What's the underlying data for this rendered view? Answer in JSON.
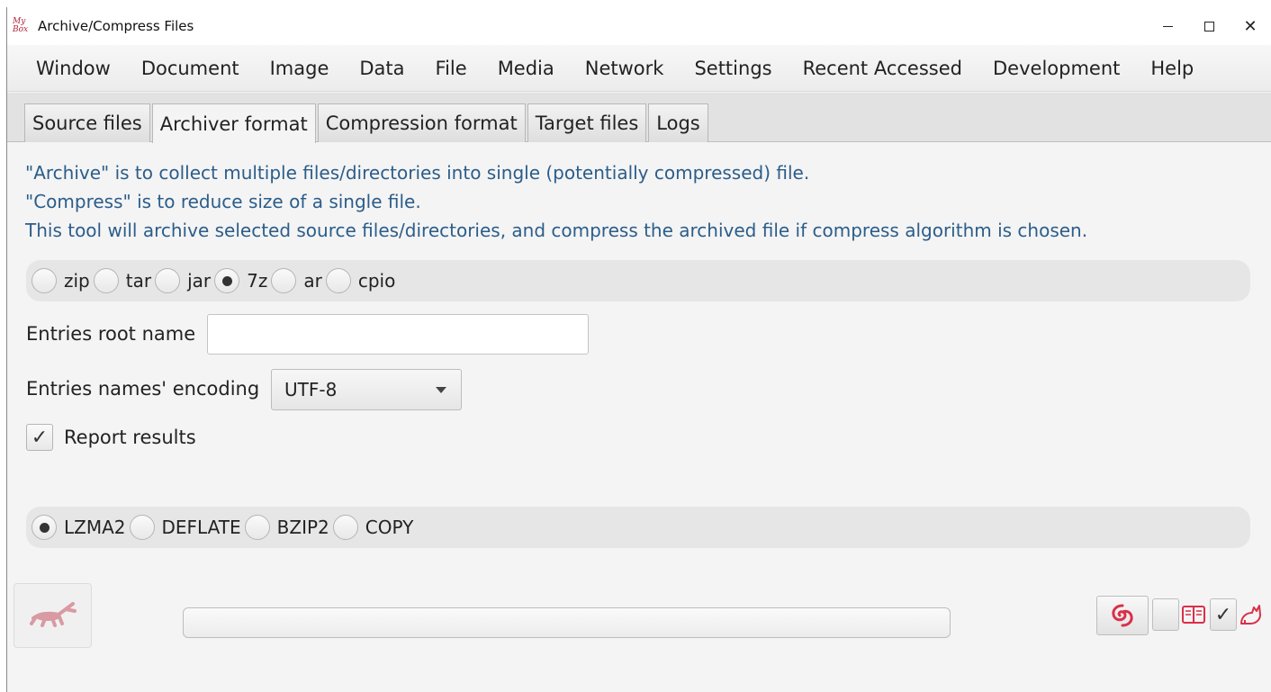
{
  "window": {
    "title": "Archive/Compress Files",
    "logo_text_top": "My",
    "logo_text_bottom": "Box",
    "controls": [
      "minimize-icon",
      "maximize-icon",
      "close-icon"
    ],
    "close_glyph": "✕"
  },
  "menubar": {
    "items": [
      "Window",
      "Document",
      "Image",
      "Data",
      "File",
      "Media",
      "Network",
      "Settings",
      "Recent Accessed",
      "Development",
      "Help"
    ]
  },
  "tabs": {
    "items": [
      "Source files",
      "Archiver format",
      "Compression format",
      "Target files",
      "Logs"
    ],
    "active": "Archiver format"
  },
  "info": {
    "line1": "\"Archive\" is to collect multiple files/directories into single (potentially compressed) file.",
    "line2": "\"Compress\" is to reduce size of a single file.",
    "line3": "This tool will archive selected source files/directories, and compress the archived file if compress algorithm is chosen."
  },
  "archiver": {
    "options": [
      "zip",
      "tar",
      "jar",
      "7z",
      "ar",
      "cpio"
    ],
    "selected": "7z"
  },
  "entries_root": {
    "label": "Entries root name",
    "value": ""
  },
  "encoding": {
    "label": "Entries names' encoding",
    "value": "UTF-8"
  },
  "report": {
    "label": "Report results",
    "checked": true,
    "check_glyph": "✓"
  },
  "compression": {
    "options": [
      "LZMA2",
      "DEFLATE",
      "BZIP2",
      "COPY"
    ],
    "selected": "LZMA2"
  },
  "progress": {
    "value": 0
  },
  "toolbar_right": {
    "check_glyph": "✓",
    "icons": [
      "shell-icon",
      "pin-icon",
      "book-icon",
      "check-icon",
      "cat-icon"
    ]
  },
  "colors": {
    "info_text": "#2b5d8a",
    "icon_red": "#d9304a",
    "start_icon": "#d99aa3"
  }
}
